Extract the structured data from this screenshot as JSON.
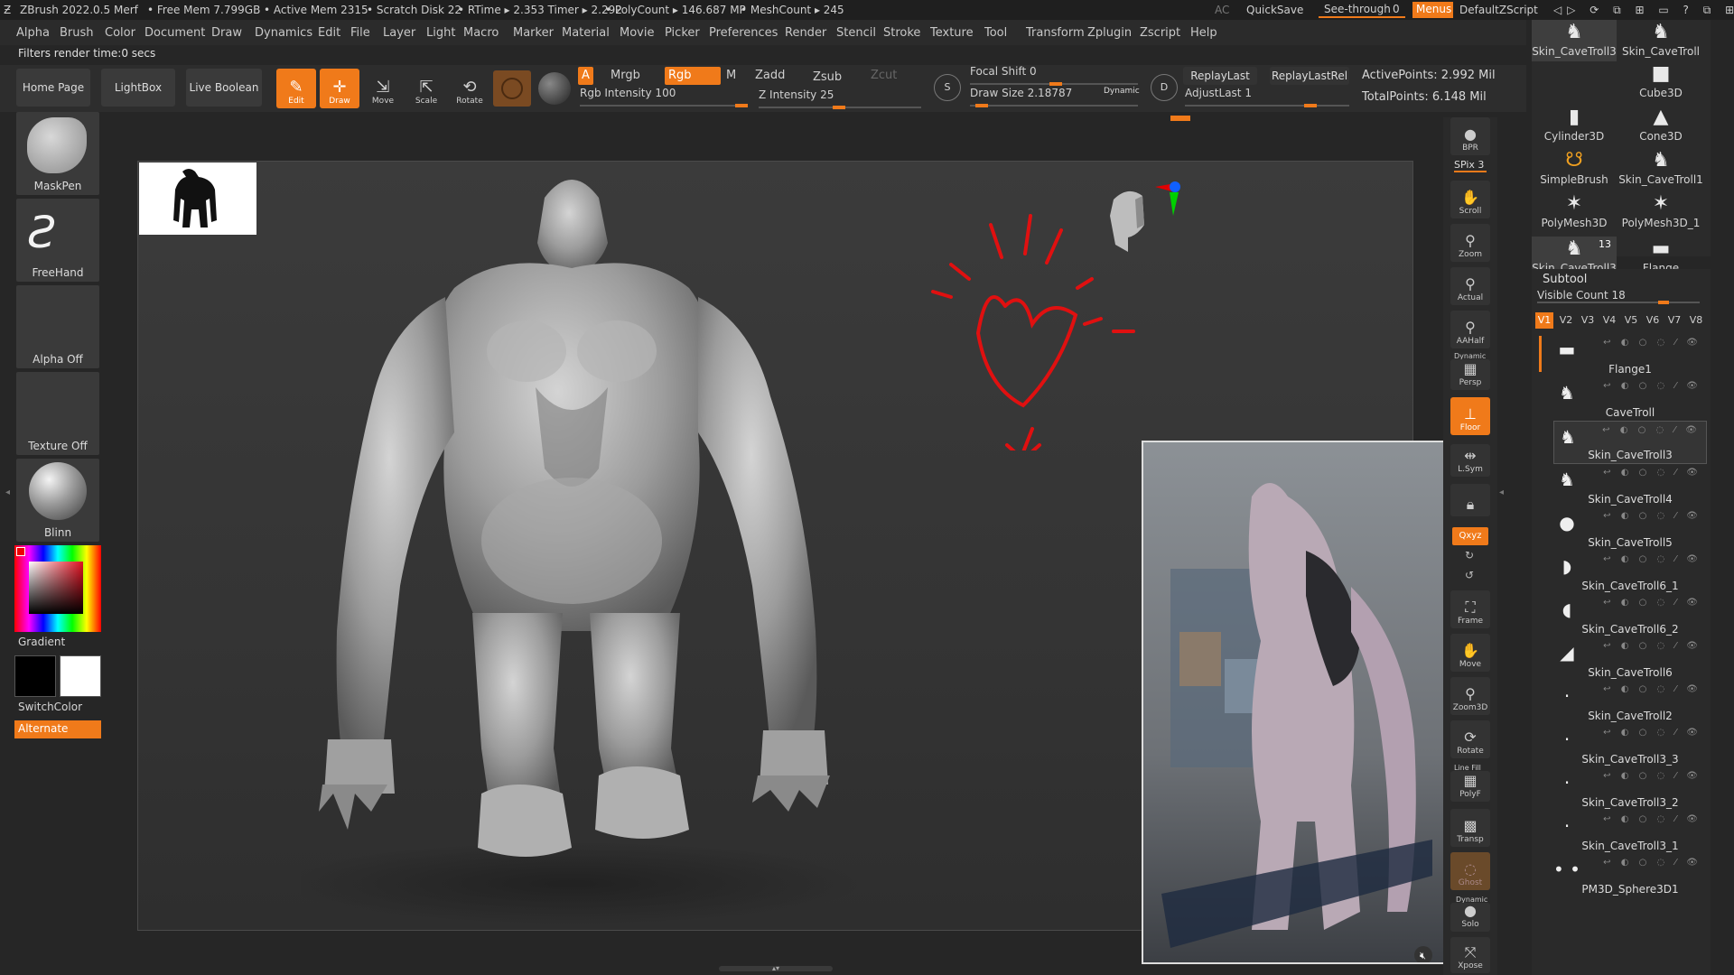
{
  "titlebar": {
    "app": "ZBrush 2022.0.5",
    "project": "Merf",
    "free_mem": "• Free Mem 7.799GB",
    "active_mem": "• Active Mem 2315",
    "scratch": "• Scratch Disk 22",
    "rtime": "• RTime ▸ 2.353 Timer ▸ 2.292",
    "polycount": "• PolyCount ▸ 146.687 MP",
    "meshcount": "• MeshCount ▸ 245",
    "ac": "AC",
    "quicksave": "QuickSave",
    "seethrough": "See-through",
    "seethrough_value": "0",
    "menus": "Menus",
    "script": "DefaultZScript"
  },
  "menubar": [
    "Alpha",
    "Brush",
    "Color",
    "Document",
    "Draw",
    "Dynamics",
    "Edit",
    "File",
    "Layer",
    "Light",
    "Macro",
    "Marker",
    "Material",
    "Movie",
    "Picker",
    "Preferences",
    "Render",
    "Stencil",
    "Stroke",
    "Texture",
    "Tool",
    "Transform",
    "Zplugin",
    "Zscript",
    "Help"
  ],
  "filters_text": "Filters render time:0 secs",
  "toolbar": {
    "home": "Home Page",
    "lightbox": "LightBox",
    "live_boolean": "Live Boolean",
    "edit": "Edit",
    "draw": "Draw",
    "move": "Move",
    "scale": "Scale",
    "rotate": "Rotate",
    "a": "A",
    "mrgb": "Mrgb",
    "rgb": "Rgb",
    "m": "M",
    "zadd": "Zadd",
    "zsub": "Zsub",
    "zcut": "Zcut",
    "rgb_intensity": "Rgb Intensity 100",
    "z_intensity": "Z Intensity 25",
    "focal_shift": "Focal Shift 0",
    "draw_size": "Draw Size 2.18787",
    "dynamic": "Dynamic",
    "replay_last": "ReplayLast",
    "replay_last_rel": "ReplayLastRel",
    "adjust_last": "AdjustLast 1",
    "active_points": "ActivePoints: 2.992 Mil",
    "total_points": "TotalPoints: 6.148 Mil"
  },
  "left_tray": {
    "brush": "MaskPen",
    "stroke": "FreeHand",
    "alpha": "Alpha Off",
    "texture": "Texture Off",
    "material": "Blinn",
    "gradient": "Gradient",
    "switchcolor": "SwitchColor",
    "alternate": "Alternate"
  },
  "right_shelf": {
    "bpr": "BPR",
    "spix": "SPix 3",
    "scroll": "Scroll",
    "zoom": "Zoom",
    "actual": "Actual",
    "aahalf": "AAHalf",
    "dynamic_label": "Dynamic",
    "persp": "Persp",
    "floor": "Floor",
    "lsym": "L.Sym",
    "xyz": "Qxyz",
    "frame": "Frame",
    "move": "Move",
    "zoom3d": "Zoom3D",
    "rotate": "Rotate",
    "linefill": "Line Fill",
    "polyf": "PolyF",
    "transp": "Transp",
    "ghost": "Ghost",
    "dynamic2": "Dynamic",
    "solo": "Solo",
    "xpose": "Xpose"
  },
  "tool_palette": [
    {
      "name": "Skin_CaveTroll3",
      "icon": "troll-icon",
      "glyph": "♞"
    },
    {
      "name": "Skin_CaveTroll",
      "icon": "troll-icon",
      "glyph": "♞"
    },
    {
      "name": "Cube3D",
      "icon": "cube-icon",
      "glyph": "■"
    },
    {
      "name": "Cylinder3D",
      "icon": "cylinder-icon",
      "glyph": "▮"
    },
    {
      "name": "Cone3D",
      "icon": "cone-icon",
      "glyph": "▲"
    },
    {
      "name": "SimpleBrush",
      "icon": "simplebrush-icon",
      "glyph": "☋"
    },
    {
      "name": "Skin_CaveTroll1",
      "icon": "troll-icon",
      "glyph": "♞"
    },
    {
      "name": "PolyMesh3D",
      "icon": "star-icon",
      "glyph": "✶"
    },
    {
      "name": "PolyMesh3D_1",
      "icon": "star-icon",
      "glyph": "✶"
    },
    {
      "name": "Skin_CaveTroll3",
      "icon": "troll-icon",
      "glyph": "♞",
      "count": "13"
    },
    {
      "name": "Flange",
      "icon": "flange-icon",
      "glyph": "▬"
    }
  ],
  "subtool": {
    "title": "Subtool",
    "visible_count": "Visible Count 18",
    "tabs": [
      "V1",
      "V2",
      "V3",
      "V4",
      "V5",
      "V6",
      "V7",
      "V8"
    ],
    "items": [
      {
        "name": "Flange1",
        "glyph": "▬"
      },
      {
        "name": "CaveTroll",
        "glyph": "♞"
      },
      {
        "name": "Skin_CaveTroll3",
        "glyph": "♞"
      },
      {
        "name": "Skin_CaveTroll4",
        "glyph": "♞"
      },
      {
        "name": "Skin_CaveTroll5",
        "glyph": "●"
      },
      {
        "name": "Skin_CaveTroll6_1",
        "glyph": "◗"
      },
      {
        "name": "Skin_CaveTroll6_2",
        "glyph": "◖"
      },
      {
        "name": "Skin_CaveTroll6",
        "glyph": "◢"
      },
      {
        "name": "Skin_CaveTroll2",
        "glyph": "·"
      },
      {
        "name": "Skin_CaveTroll3_3",
        "glyph": "·"
      },
      {
        "name": "Skin_CaveTroll3_2",
        "glyph": "·"
      },
      {
        "name": "Skin_CaveTroll3_1",
        "glyph": "·"
      },
      {
        "name": "PM3D_Sphere3D1",
        "glyph": "• •"
      }
    ]
  },
  "colors": {
    "accent": "#f07a1a",
    "background": "#262626",
    "panel": "#2b2b2b",
    "annotation": "#e01010",
    "primary_color": "#000000",
    "secondary_color": "#ffffff"
  }
}
